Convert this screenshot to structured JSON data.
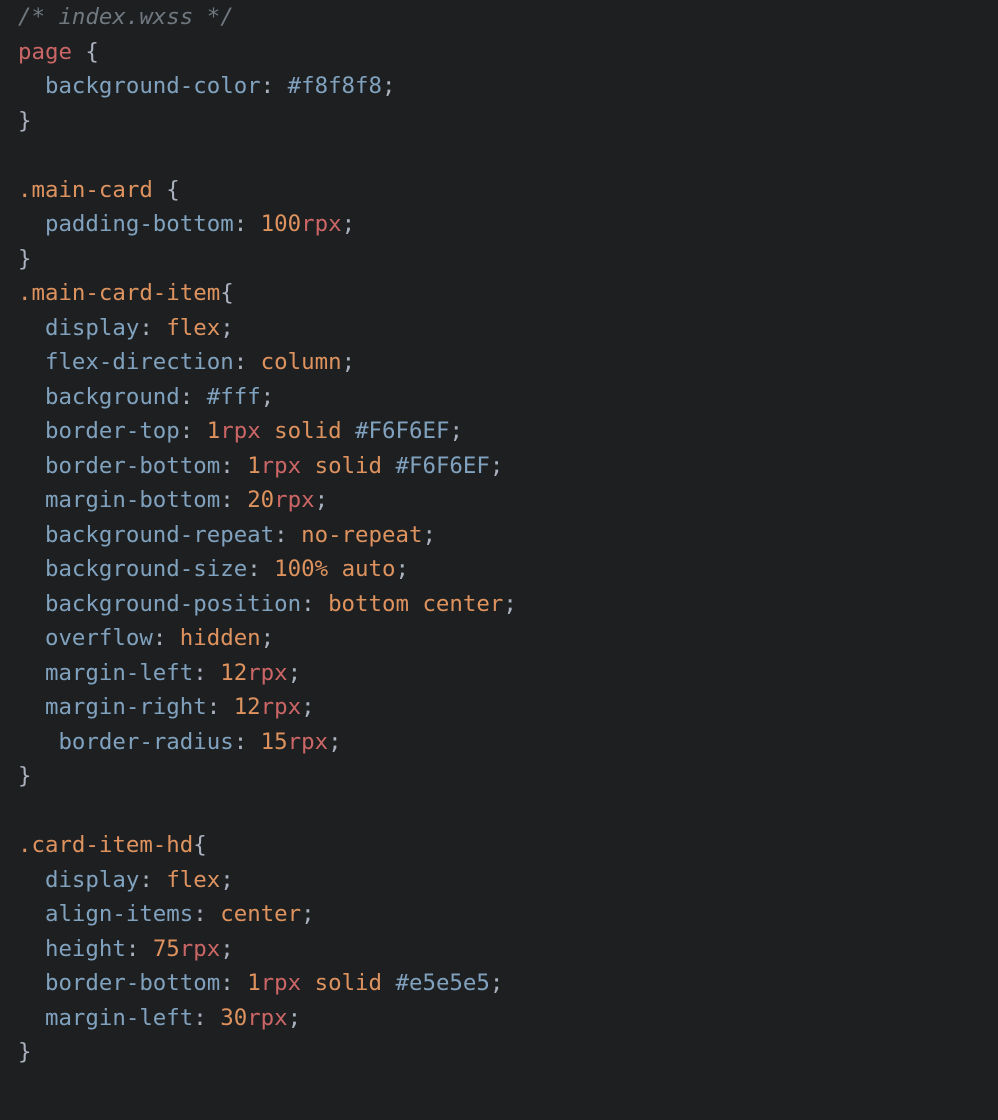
{
  "code": {
    "lines": [
      [
        {
          "cls": "comment",
          "text": "/* index.wxss */"
        }
      ],
      [
        {
          "cls": "sel-tag",
          "text": "page"
        },
        {
          "cls": "plain",
          "text": " "
        },
        {
          "cls": "brace",
          "text": "{"
        }
      ],
      [
        {
          "cls": "plain",
          "text": "  "
        },
        {
          "cls": "prop",
          "text": "background-color"
        },
        {
          "cls": "punct",
          "text": ":"
        },
        {
          "cls": "plain",
          "text": " "
        },
        {
          "cls": "hex",
          "text": "#f8f8f8"
        },
        {
          "cls": "punct",
          "text": ";"
        }
      ],
      [
        {
          "cls": "brace",
          "text": "}"
        }
      ],
      [
        {
          "cls": "plain",
          "text": ""
        }
      ],
      [
        {
          "cls": "sel-class",
          "text": ".main-card"
        },
        {
          "cls": "plain",
          "text": " "
        },
        {
          "cls": "brace",
          "text": "{"
        }
      ],
      [
        {
          "cls": "plain",
          "text": "  "
        },
        {
          "cls": "prop",
          "text": "padding-bottom"
        },
        {
          "cls": "punct",
          "text": ":"
        },
        {
          "cls": "plain",
          "text": " "
        },
        {
          "cls": "num",
          "text": "100"
        },
        {
          "cls": "unit",
          "text": "rpx"
        },
        {
          "cls": "punct",
          "text": ";"
        }
      ],
      [
        {
          "cls": "brace",
          "text": "}"
        }
      ],
      [
        {
          "cls": "sel-class",
          "text": ".main-card-item"
        },
        {
          "cls": "brace",
          "text": "{"
        }
      ],
      [
        {
          "cls": "plain",
          "text": "  "
        },
        {
          "cls": "prop",
          "text": "display"
        },
        {
          "cls": "punct",
          "text": ":"
        },
        {
          "cls": "plain",
          "text": " "
        },
        {
          "cls": "val",
          "text": "flex"
        },
        {
          "cls": "punct",
          "text": ";"
        }
      ],
      [
        {
          "cls": "plain",
          "text": "  "
        },
        {
          "cls": "prop",
          "text": "flex-direction"
        },
        {
          "cls": "punct",
          "text": ":"
        },
        {
          "cls": "plain",
          "text": " "
        },
        {
          "cls": "val",
          "text": "column"
        },
        {
          "cls": "punct",
          "text": ";"
        }
      ],
      [
        {
          "cls": "plain",
          "text": "  "
        },
        {
          "cls": "prop",
          "text": "background"
        },
        {
          "cls": "punct",
          "text": ":"
        },
        {
          "cls": "plain",
          "text": " "
        },
        {
          "cls": "hex",
          "text": "#fff"
        },
        {
          "cls": "punct",
          "text": ";"
        }
      ],
      [
        {
          "cls": "plain",
          "text": "  "
        },
        {
          "cls": "prop",
          "text": "border-top"
        },
        {
          "cls": "punct",
          "text": ":"
        },
        {
          "cls": "plain",
          "text": " "
        },
        {
          "cls": "num",
          "text": "1"
        },
        {
          "cls": "unit",
          "text": "rpx"
        },
        {
          "cls": "plain",
          "text": " "
        },
        {
          "cls": "val",
          "text": "solid"
        },
        {
          "cls": "plain",
          "text": " "
        },
        {
          "cls": "hex",
          "text": "#F6F6EF"
        },
        {
          "cls": "punct",
          "text": ";"
        }
      ],
      [
        {
          "cls": "plain",
          "text": "  "
        },
        {
          "cls": "prop",
          "text": "border-bottom"
        },
        {
          "cls": "punct",
          "text": ":"
        },
        {
          "cls": "plain",
          "text": " "
        },
        {
          "cls": "num",
          "text": "1"
        },
        {
          "cls": "unit",
          "text": "rpx"
        },
        {
          "cls": "plain",
          "text": " "
        },
        {
          "cls": "val",
          "text": "solid"
        },
        {
          "cls": "plain",
          "text": " "
        },
        {
          "cls": "hex",
          "text": "#F6F6EF"
        },
        {
          "cls": "punct",
          "text": ";"
        }
      ],
      [
        {
          "cls": "plain",
          "text": "  "
        },
        {
          "cls": "prop",
          "text": "margin-bottom"
        },
        {
          "cls": "punct",
          "text": ":"
        },
        {
          "cls": "plain",
          "text": " "
        },
        {
          "cls": "num",
          "text": "20"
        },
        {
          "cls": "unit",
          "text": "rpx"
        },
        {
          "cls": "punct",
          "text": ";"
        }
      ],
      [
        {
          "cls": "plain",
          "text": "  "
        },
        {
          "cls": "prop",
          "text": "background-repeat"
        },
        {
          "cls": "punct",
          "text": ":"
        },
        {
          "cls": "plain",
          "text": " "
        },
        {
          "cls": "val",
          "text": "no-repeat"
        },
        {
          "cls": "punct",
          "text": ";"
        }
      ],
      [
        {
          "cls": "plain",
          "text": "  "
        },
        {
          "cls": "prop",
          "text": "background-size"
        },
        {
          "cls": "punct",
          "text": ":"
        },
        {
          "cls": "plain",
          "text": " "
        },
        {
          "cls": "num",
          "text": "100%"
        },
        {
          "cls": "plain",
          "text": " "
        },
        {
          "cls": "val",
          "text": "auto"
        },
        {
          "cls": "punct",
          "text": ";"
        }
      ],
      [
        {
          "cls": "plain",
          "text": "  "
        },
        {
          "cls": "prop",
          "text": "background-position"
        },
        {
          "cls": "punct",
          "text": ":"
        },
        {
          "cls": "plain",
          "text": " "
        },
        {
          "cls": "val",
          "text": "bottom"
        },
        {
          "cls": "plain",
          "text": " "
        },
        {
          "cls": "val",
          "text": "center"
        },
        {
          "cls": "punct",
          "text": ";"
        }
      ],
      [
        {
          "cls": "plain",
          "text": "  "
        },
        {
          "cls": "prop",
          "text": "overflow"
        },
        {
          "cls": "punct",
          "text": ":"
        },
        {
          "cls": "plain",
          "text": " "
        },
        {
          "cls": "val",
          "text": "hidden"
        },
        {
          "cls": "punct",
          "text": ";"
        }
      ],
      [
        {
          "cls": "plain",
          "text": "  "
        },
        {
          "cls": "prop",
          "text": "margin-left"
        },
        {
          "cls": "punct",
          "text": ":"
        },
        {
          "cls": "plain",
          "text": " "
        },
        {
          "cls": "num",
          "text": "12"
        },
        {
          "cls": "unit",
          "text": "rpx"
        },
        {
          "cls": "punct",
          "text": ";"
        }
      ],
      [
        {
          "cls": "plain",
          "text": "  "
        },
        {
          "cls": "prop",
          "text": "margin-right"
        },
        {
          "cls": "punct",
          "text": ":"
        },
        {
          "cls": "plain",
          "text": " "
        },
        {
          "cls": "num",
          "text": "12"
        },
        {
          "cls": "unit",
          "text": "rpx"
        },
        {
          "cls": "punct",
          "text": ";"
        }
      ],
      [
        {
          "cls": "plain",
          "text": "   "
        },
        {
          "cls": "prop",
          "text": "border-radius"
        },
        {
          "cls": "punct",
          "text": ":"
        },
        {
          "cls": "plain",
          "text": " "
        },
        {
          "cls": "num",
          "text": "15"
        },
        {
          "cls": "unit",
          "text": "rpx"
        },
        {
          "cls": "punct",
          "text": ";"
        }
      ],
      [
        {
          "cls": "brace",
          "text": "}"
        }
      ],
      [
        {
          "cls": "plain",
          "text": ""
        }
      ],
      [
        {
          "cls": "sel-class",
          "text": ".card-item-hd"
        },
        {
          "cls": "brace",
          "text": "{"
        }
      ],
      [
        {
          "cls": "plain",
          "text": "  "
        },
        {
          "cls": "prop",
          "text": "display"
        },
        {
          "cls": "punct",
          "text": ":"
        },
        {
          "cls": "plain",
          "text": " "
        },
        {
          "cls": "val",
          "text": "flex"
        },
        {
          "cls": "punct",
          "text": ";"
        }
      ],
      [
        {
          "cls": "plain",
          "text": "  "
        },
        {
          "cls": "prop",
          "text": "align-items"
        },
        {
          "cls": "punct",
          "text": ":"
        },
        {
          "cls": "plain",
          "text": " "
        },
        {
          "cls": "val",
          "text": "center"
        },
        {
          "cls": "punct",
          "text": ";"
        }
      ],
      [
        {
          "cls": "plain",
          "text": "  "
        },
        {
          "cls": "prop",
          "text": "height"
        },
        {
          "cls": "punct",
          "text": ":"
        },
        {
          "cls": "plain",
          "text": " "
        },
        {
          "cls": "num",
          "text": "75"
        },
        {
          "cls": "unit",
          "text": "rpx"
        },
        {
          "cls": "punct",
          "text": ";"
        }
      ],
      [
        {
          "cls": "plain",
          "text": "  "
        },
        {
          "cls": "prop",
          "text": "border-bottom"
        },
        {
          "cls": "punct",
          "text": ":"
        },
        {
          "cls": "plain",
          "text": " "
        },
        {
          "cls": "num",
          "text": "1"
        },
        {
          "cls": "unit",
          "text": "rpx"
        },
        {
          "cls": "plain",
          "text": " "
        },
        {
          "cls": "val",
          "text": "solid"
        },
        {
          "cls": "plain",
          "text": " "
        },
        {
          "cls": "hex",
          "text": "#e5e5e5"
        },
        {
          "cls": "punct",
          "text": ";"
        }
      ],
      [
        {
          "cls": "plain",
          "text": "  "
        },
        {
          "cls": "prop",
          "text": "margin-left"
        },
        {
          "cls": "punct",
          "text": ":"
        },
        {
          "cls": "plain",
          "text": " "
        },
        {
          "cls": "num",
          "text": "30"
        },
        {
          "cls": "unit",
          "text": "rpx"
        },
        {
          "cls": "punct",
          "text": ";"
        }
      ],
      [
        {
          "cls": "brace",
          "text": "}"
        }
      ]
    ]
  },
  "colors": {
    "comment": "#707880",
    "sel-tag": "#cc6666",
    "sel-class": "#de935f",
    "brace": "#abb2bf",
    "plain": "#abb2bf",
    "punct": "#abb2bf",
    "prop": "#81a2be",
    "val": "#de935f",
    "num": "#de935f",
    "unit": "#cc6666",
    "hex": "#81a2be"
  },
  "styles": {
    "comment": "italic"
  }
}
